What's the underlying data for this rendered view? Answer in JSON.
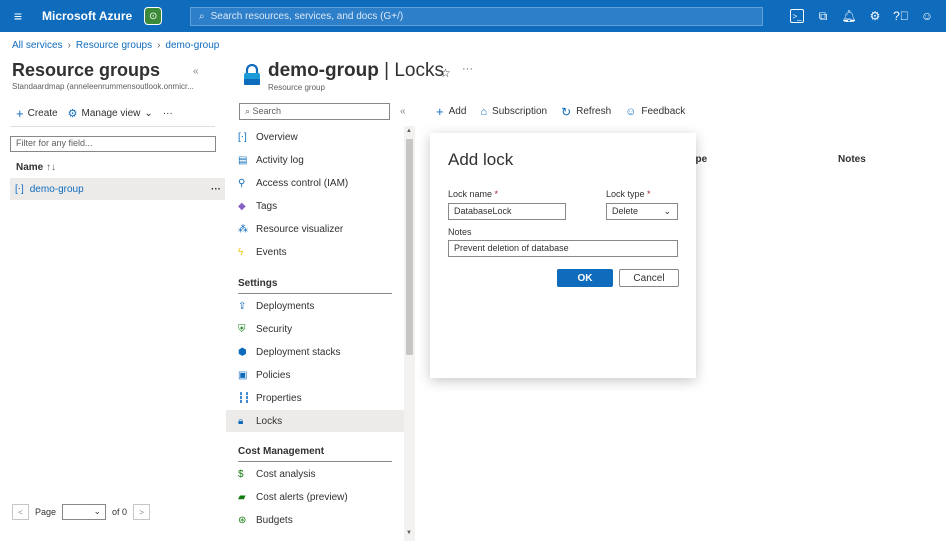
{
  "topbar": {
    "brand": "Microsoft Azure",
    "search_placeholder": "Search resources, services, and docs (G+/)",
    "icons": [
      "cloud-shell-icon",
      "directory-filter-icon",
      "notifications-icon",
      "settings-icon",
      "help-icon",
      "feedback-icon"
    ]
  },
  "breadcrumb": [
    "All services",
    "Resource groups",
    "demo-group"
  ],
  "left_panel": {
    "title": "Resource groups",
    "subtitle": "Standaardmap (anneleenrummensoutlook.onmicr...",
    "toolbar": {
      "create": "Create",
      "manage_view": "Manage view"
    },
    "filter_placeholder": "Filter for any field...",
    "column_name": "Name",
    "sort_indicator": "↑↓",
    "rows": [
      {
        "name": "demo-group"
      }
    ],
    "pager": {
      "page_label": "Page",
      "of_label": "of 0"
    }
  },
  "resource": {
    "name": "demo-group",
    "section": "Locks",
    "type": "Resource group"
  },
  "nav": {
    "search_placeholder": "Search",
    "items": [
      {
        "label": "Overview",
        "icon": "overview-icon"
      },
      {
        "label": "Activity log",
        "icon": "activity-log-icon"
      },
      {
        "label": "Access control (IAM)",
        "icon": "iam-icon"
      },
      {
        "label": "Tags",
        "icon": "tag-icon"
      },
      {
        "label": "Resource visualizer",
        "icon": "visualizer-icon"
      },
      {
        "label": "Events",
        "icon": "events-icon"
      }
    ],
    "settings_header": "Settings",
    "settings_items": [
      {
        "label": "Deployments",
        "icon": "deployments-icon"
      },
      {
        "label": "Security",
        "icon": "security-icon"
      },
      {
        "label": "Deployment stacks",
        "icon": "deployment-stacks-icon"
      },
      {
        "label": "Policies",
        "icon": "policies-icon"
      },
      {
        "label": "Properties",
        "icon": "properties-icon"
      },
      {
        "label": "Locks",
        "icon": "lock-icon",
        "selected": true
      }
    ],
    "cost_header": "Cost Management",
    "cost_items": [
      {
        "label": "Cost analysis",
        "icon": "cost-analysis-icon"
      },
      {
        "label": "Cost alerts (preview)",
        "icon": "cost-alerts-icon"
      },
      {
        "label": "Budgets",
        "icon": "budgets-icon"
      }
    ]
  },
  "commands": {
    "add": "Add",
    "subscription": "Subscription",
    "refresh": "Refresh",
    "feedback": "Feedback"
  },
  "table": {
    "col_type_partial": "ype",
    "col_notes": "Notes"
  },
  "dialog": {
    "title": "Add lock",
    "lock_name_label": "Lock name",
    "lock_name_value": "DatabaseLock",
    "lock_type_label": "Lock type",
    "lock_type_value": "Delete",
    "notes_label": "Notes",
    "notes_value": "Prevent deletion of database",
    "ok": "OK",
    "cancel": "Cancel",
    "required_marker": "*"
  },
  "colors": {
    "accent": "#0f6cbd",
    "selected_bg": "#edebe9",
    "required": "#a4262c"
  }
}
